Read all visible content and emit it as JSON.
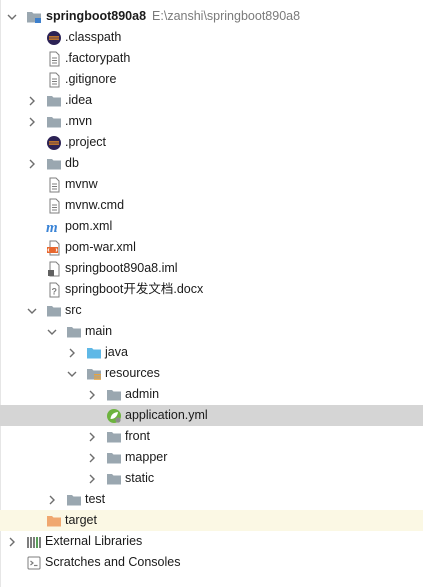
{
  "tree": {
    "root": {
      "name": "springboot890a8",
      "path": "E:\\zanshi\\springboot890a8"
    },
    "items": [
      {
        "label": ".classpath"
      },
      {
        "label": ".factorypath"
      },
      {
        "label": ".gitignore"
      },
      {
        "label": ".idea"
      },
      {
        "label": ".mvn"
      },
      {
        "label": ".project"
      },
      {
        "label": "db"
      },
      {
        "label": "mvnw"
      },
      {
        "label": "mvnw.cmd"
      },
      {
        "label": "pom.xml"
      },
      {
        "label": "pom-war.xml"
      },
      {
        "label": "springboot890a8.iml"
      },
      {
        "label": "springboot开发文档.docx"
      },
      {
        "label": "src"
      },
      {
        "label": "main"
      },
      {
        "label": "java"
      },
      {
        "label": "resources"
      },
      {
        "label": "admin"
      },
      {
        "label": "application.yml"
      },
      {
        "label": "front"
      },
      {
        "label": "mapper"
      },
      {
        "label": "static"
      },
      {
        "label": "test"
      },
      {
        "label": "target"
      }
    ]
  },
  "external_libraries": "External Libraries",
  "scratches": "Scratches and Consoles"
}
